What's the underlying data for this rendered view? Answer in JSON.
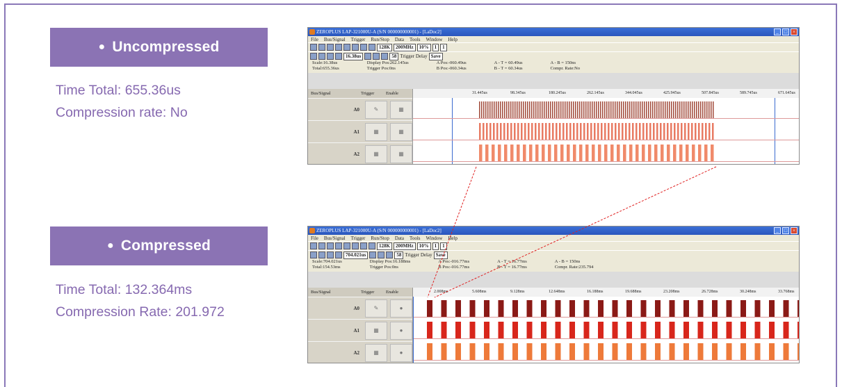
{
  "sections": [
    {
      "title": "Uncompressed",
      "line1": "Time Total: 655.36us",
      "line2": "Compression rate: No"
    },
    {
      "title": "Compressed",
      "line1": "Time Total: 132.364ms",
      "line2": "Compression Rate: 201.972"
    }
  ],
  "windows": [
    {
      "title": "ZEROPLUS LAP-321000U-A (S/N 000000000001) - [LaDoc2]",
      "menu": [
        "File",
        "Bus/Signal",
        "Trigger",
        "Run/Stop",
        "Data",
        "Tools",
        "Window",
        "Help"
      ],
      "memory": "128K",
      "rate": "200MHz",
      "zoom": "16.38us",
      "percent": "10%",
      "page": "1",
      "count": "1",
      "height": "58",
      "trigger_delay": "Trigger Delay",
      "save": "Save",
      "info": [
        "Scale:16.38us",
        "Total:655.36us",
        "Display Pos:262.145us",
        "Trigger Pos:0ns",
        "A Pos:-060.49us",
        "B Pos:-060.34us",
        "A - T = 60.49us",
        "B - T = 60.34us",
        "A - B = 150ns",
        "Compr. Rate:No"
      ],
      "ticks": [
        "",
        "31.445us",
        "98.345us",
        "180.245us",
        "262.145us",
        "344.045us",
        "425.945us",
        "507.845us",
        "589.745us",
        "671.645us"
      ],
      "channels": [
        "A0",
        "A1",
        "A2"
      ],
      "col_headers": [
        "Bus/Signal",
        "Trigger",
        "Enable"
      ],
      "colors": {
        "a0": "#a14a3a",
        "a1": "#e87a62",
        "a2": "#f08a6a"
      }
    },
    {
      "title": "ZEROPLUS LAP-321000U-A (S/N 000000000001) - [LaDoc2]",
      "menu": [
        "File",
        "Bus/Signal",
        "Trigger",
        "Run/Stop",
        "Data",
        "Tools",
        "Window",
        "Help"
      ],
      "memory": "128K",
      "rate": "200MHz",
      "zoom": "704.021us",
      "percent": "10%",
      "page": "1",
      "count": "1",
      "height": "58",
      "trigger_delay": "Trigger Delay",
      "save": "Save",
      "info": [
        "Scale:704.021us",
        "Total:154.53ms",
        "Display Pos:16.188ms",
        "Trigger Pos:0ns",
        "A Pos:-016.77ms",
        "B Pos:-016.77ms",
        "A - T = 16.77ms",
        "B - T = 16.77ms",
        "A - B = 150ns",
        "Compr. Rate:235.794"
      ],
      "ticks": [
        "2.008ms",
        "5.608ms",
        "9.128ms",
        "12.648ms",
        "16.188ms",
        "19.688ms",
        "23.208ms",
        "26.728ms",
        "30.248ms",
        "33.768ms"
      ],
      "channels": [
        "A0",
        "A1",
        "A2"
      ],
      "col_headers": [
        "Bus/Signal",
        "Trigger",
        "Enable"
      ],
      "colors": {
        "a0": "#8b1a16",
        "a1": "#d8261b",
        "a2": "#ee7a3a"
      }
    }
  ]
}
